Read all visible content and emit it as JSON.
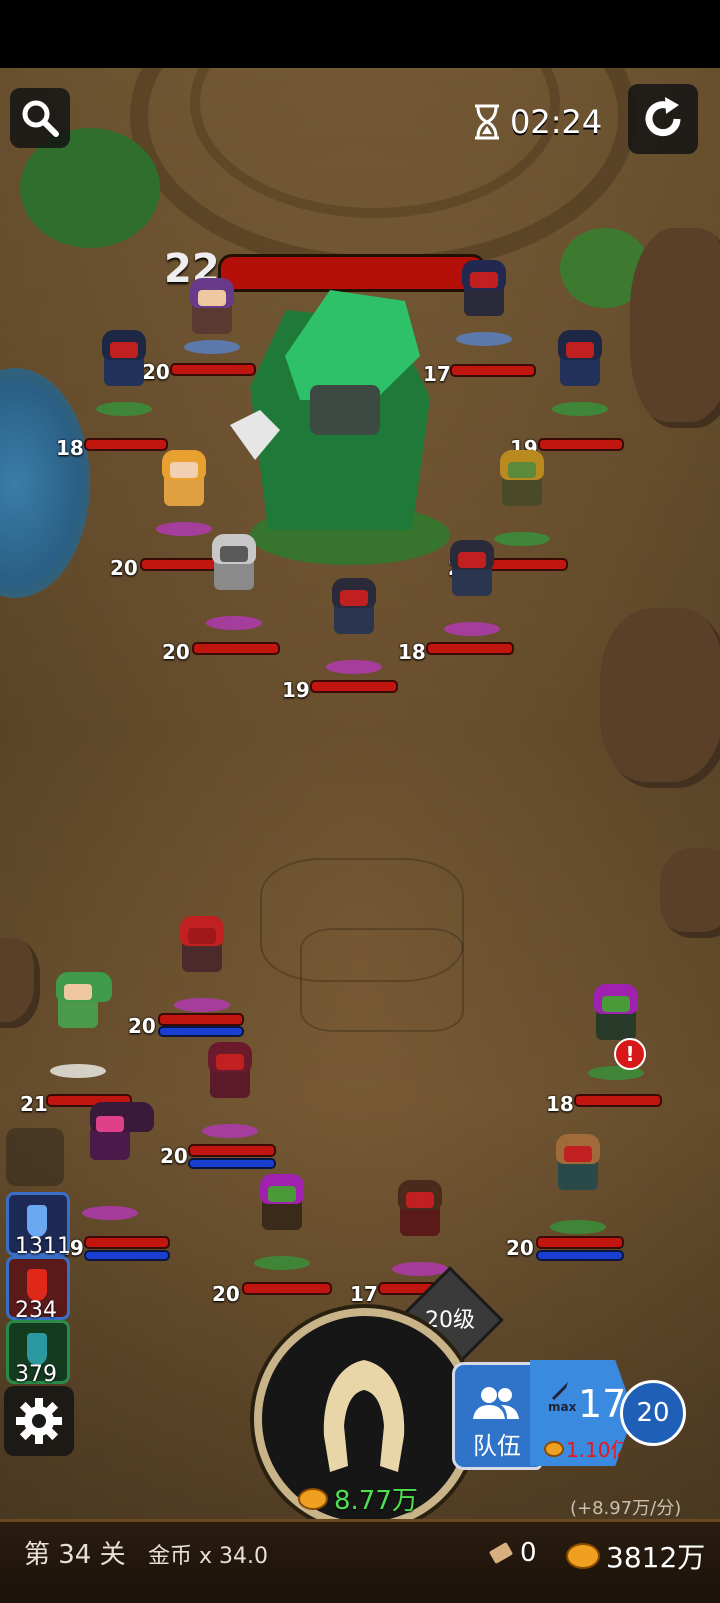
{
  "timer": "02:24",
  "boss": {
    "level": "22"
  },
  "enemies": [
    {
      "level": "20"
    },
    {
      "level": "17"
    },
    {
      "level": "18"
    },
    {
      "level": "19"
    },
    {
      "level": "20"
    },
    {
      "level": "20"
    },
    {
      "level": "20"
    },
    {
      "level": "18"
    },
    {
      "level": "19"
    }
  ],
  "allies": [
    {
      "level": "20"
    },
    {
      "level": "21"
    },
    {
      "level": "20"
    },
    {
      "level": "18"
    },
    {
      "level": "19"
    },
    {
      "level": "20"
    },
    {
      "level": "17"
    },
    {
      "level": "20"
    }
  ],
  "potions": [
    {
      "name": "blue-potion",
      "count": "1311"
    },
    {
      "name": "red-potion",
      "count": "234"
    },
    {
      "name": "green-potion",
      "count": "379"
    }
  ],
  "summon": {
    "cost": "8.77万",
    "level_tag": "20级"
  },
  "team": {
    "label": "队伍"
  },
  "upgrade": {
    "max": "max",
    "level": "17",
    "cost": "1.10亿"
  },
  "player_level": "20",
  "income_rate": "(+8.97万/分)",
  "stage": "第 34 关",
  "gold_multiplier": "金币 x 34.0",
  "tickets": "0",
  "gold": "3812万",
  "colors": {
    "hp": "#c0160f",
    "mp": "#1a3fd0",
    "accent_blue": "#2f74c8"
  }
}
